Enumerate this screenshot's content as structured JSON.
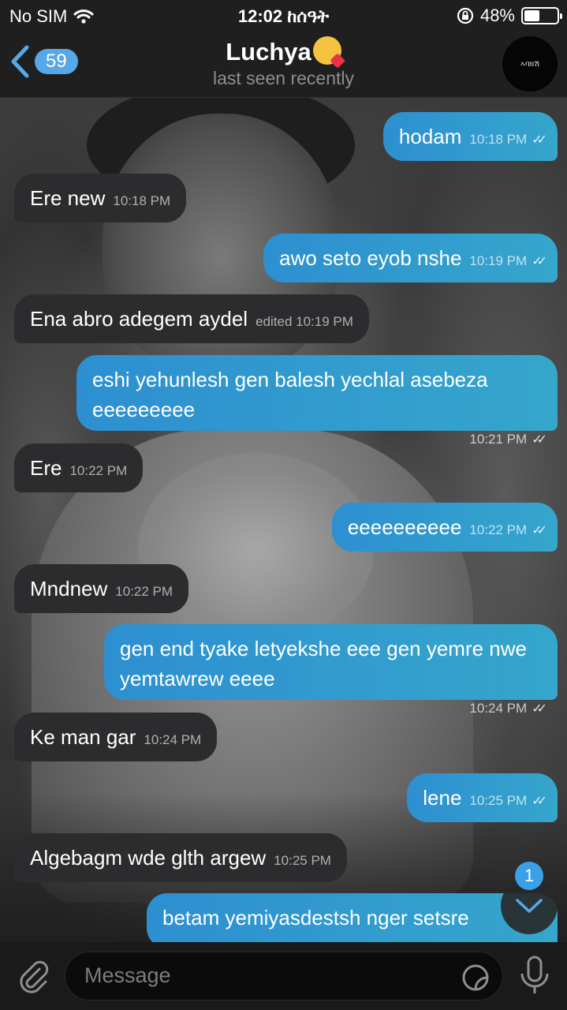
{
  "status_bar": {
    "carrier": "No SIM",
    "time": "12:02 ከሰዓት",
    "battery_percent": "48%",
    "battery_level": 0.48
  },
  "header": {
    "back_count": "59",
    "title": "Luchya",
    "title_emoji": "kissing-face-emoji",
    "subtitle": "last seen recently",
    "avatar_label": "ኣባክሽ"
  },
  "messages": [
    {
      "dir": "out",
      "text": "hodam",
      "time": "10:18 PM"
    },
    {
      "dir": "in",
      "text": "Ere new",
      "time": "10:18 PM"
    },
    {
      "dir": "out",
      "text": "awo seto eyob nshe",
      "time": "10:19 PM"
    },
    {
      "dir": "in",
      "text": "Ena abro adegem aydel",
      "time": "edited 10:19 PM"
    },
    {
      "dir": "out",
      "text": "eshi yehunlesh gen balesh yechlal asebeza eeeeeeeee",
      "time": "10:21 PM"
    },
    {
      "dir": "in",
      "text": "Ere",
      "time": "10:22 PM"
    },
    {
      "dir": "out",
      "text": "eeeeeeeeee",
      "time": "10:22 PM"
    },
    {
      "dir": "in",
      "text": "Mndnew",
      "time": "10:22 PM"
    },
    {
      "dir": "out",
      "text": "gen end tyake letyekshe eee gen yemre nwe yemtawrew eeee",
      "time": "10:24 PM"
    },
    {
      "dir": "in",
      "text": "Ke man gar",
      "time": "10:24 PM"
    },
    {
      "dir": "out",
      "text": "lene",
      "time": "10:25 PM"
    },
    {
      "dir": "in",
      "text": "Algebagm wde glth argew",
      "time": "10:25 PM"
    },
    {
      "dir": "out",
      "text": "betam yemiyasdestsh nger setsre",
      "time": ""
    }
  ],
  "scroll_down": {
    "unread_count": "1"
  },
  "composer": {
    "placeholder": "Message"
  },
  "icons": {
    "wifi": "wifi-icon",
    "lock": "rotation-lock-icon",
    "battery": "battery-icon",
    "back": "chevron-left-icon",
    "attach": "paperclip-icon",
    "sticker": "sticker-icon",
    "mic": "microphone-icon",
    "scroll": "chevron-down-icon"
  },
  "colors": {
    "outgoing_bubble": "#2d8fd0",
    "incoming_bubble": "#2c2c2e",
    "accent": "#56a8e8",
    "bar": "#1f1f1f"
  }
}
